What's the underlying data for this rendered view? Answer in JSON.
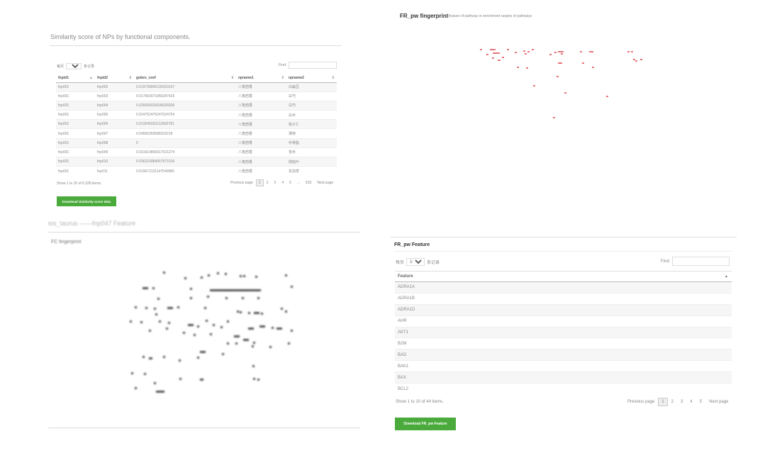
{
  "similarity": {
    "title": "Similarity score of NPs by functional components.",
    "length_prefix": "每页",
    "length_value": "10",
    "length_suffix": "条记录",
    "find_label": "Find:",
    "columns": [
      "fnpid1",
      "fnpid2",
      "gobev_coef",
      "npname1",
      "npname2"
    ],
    "rows": [
      [
        "fnp001",
        "fnp002",
        "0.019736842105263157",
        "八角茴香",
        "白扁豆"
      ],
      [
        "fnp001",
        "fnp003",
        "0.017964071856287425",
        "八角茴香",
        "白芍"
      ],
      [
        "fnp001",
        "fnp004",
        "0.026936026936026935",
        "八角茴香",
        "白芍"
      ],
      [
        "fnp001",
        "fnp005",
        "0.024752475247524754",
        "八角茴香",
        "白术"
      ],
      [
        "fnp001",
        "fnp006",
        "0.013245033112582781",
        "八角茴香",
        "柏子仁"
      ],
      [
        "fnp001",
        "fnp007",
        "0.04560260586319218",
        "八角茴香",
        "薄荷"
      ],
      [
        "fnp001",
        "fnp008",
        "0",
        "八角茴香",
        "补骨脂"
      ],
      [
        "fnp001",
        "fnp009",
        "0.031914893617021274",
        "八角茴香",
        "苍术"
      ],
      [
        "fnp001",
        "fnp010",
        "0.036231884057971016",
        "八角茴香",
        "侧柏叶"
      ],
      [
        "fnp001",
        "fnp011",
        "0.019672131147540985",
        "八角茴香",
        "车前草"
      ]
    ],
    "info": "Show 1 to 10 of 6,328 items.",
    "pager": [
      "Previous page",
      "1",
      "2",
      "3",
      "4",
      "5",
      "...",
      "633",
      "Next page"
    ],
    "download_label": "Download Similarity score data"
  },
  "fc": {
    "heading": "ios_taurus ——fnp047 Feature",
    "subheading": "FC fingerprint"
  },
  "fr": {
    "title": "FR_pw fingerprint",
    "description": "feature of pathway in enrichment targets of pathways",
    "dot_color": "#e8747c"
  },
  "feature": {
    "title": "FR_pw Feature",
    "length_prefix": "每页",
    "length_value": "10",
    "length_suffix": "条记录",
    "find_label": "Find:",
    "column": "Feature",
    "rows": [
      "ADRA1A",
      "ADRA1B",
      "ADRA1D",
      "AHR",
      "AKT1",
      "B2M",
      "BAD",
      "BAK1",
      "BAX",
      "BCL2"
    ],
    "info": "Show 1 to 10 of 44 items.",
    "pager": [
      "Previous page",
      "1",
      "2",
      "3",
      "4",
      "5",
      "Next page"
    ],
    "download_label": "Download FR_pw Feature"
  },
  "colors": {
    "accent_green": "#4aaa3b"
  }
}
